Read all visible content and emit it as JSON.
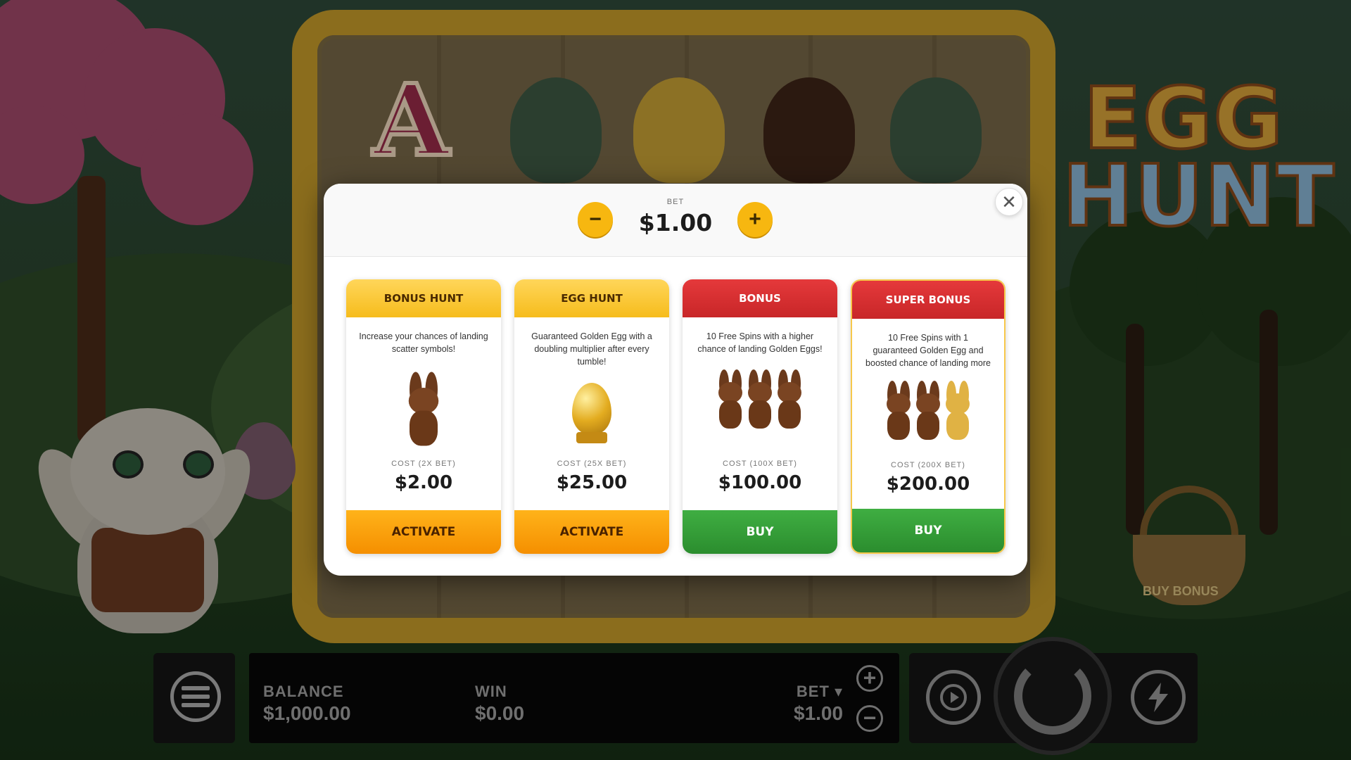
{
  "modal": {
    "bet_label": "BET",
    "bet_value": "$1.00",
    "decrease_label": "−",
    "increase_label": "+",
    "close_label": "✕",
    "cards": [
      {
        "title": "Bonus Hunt",
        "description": "Increase your chances of landing scatter symbols!",
        "cost_label": "COST (2X BET)",
        "cost_value": "$2.00",
        "button_label": "Activate",
        "head_color": "#f6bc1c",
        "button_color": "#f58f00"
      },
      {
        "title": "Egg Hunt",
        "description": "Guaranteed Golden Egg with a doubling multiplier after every tumble!",
        "cost_label": "COST (25X BET)",
        "cost_value": "$25.00",
        "button_label": "Activate",
        "head_color": "#f6bc1c",
        "button_color": "#f58f00"
      },
      {
        "title": "Bonus",
        "description": "10 Free Spins with a higher chance of landing Golden Eggs!",
        "cost_label": "COST (100X BET)",
        "cost_value": "$100.00",
        "button_label": "Buy",
        "head_color": "#c82628",
        "button_color": "#2b8d2e"
      },
      {
        "title": "Super Bonus",
        "description": "10 Free Spins with 1 guaranteed Golden Egg and boosted chance of landing more",
        "cost_label": "COST (200X BET)",
        "cost_value": "$200.00",
        "button_label": "Buy",
        "head_color": "#c82628",
        "button_color": "#2b8d2e"
      }
    ]
  },
  "game": {
    "logo_line1": "EGG",
    "logo_line2": "HUNT",
    "reel_letter": "A",
    "basket_label": "BUY BONUS"
  },
  "bottom_bar": {
    "balance_label": "BALANCE",
    "balance_value": "$1,000.00",
    "win_label": "WIN",
    "win_value": "$0.00",
    "bet_label": "BET ▾",
    "bet_value": "$1.00",
    "bet_plus": "+",
    "bet_minus": "−"
  },
  "icons": [
    "menu-icon",
    "autoplay-icon",
    "spin-icon",
    "turbo-icon",
    "close-icon",
    "minus-icon",
    "plus-icon"
  ]
}
